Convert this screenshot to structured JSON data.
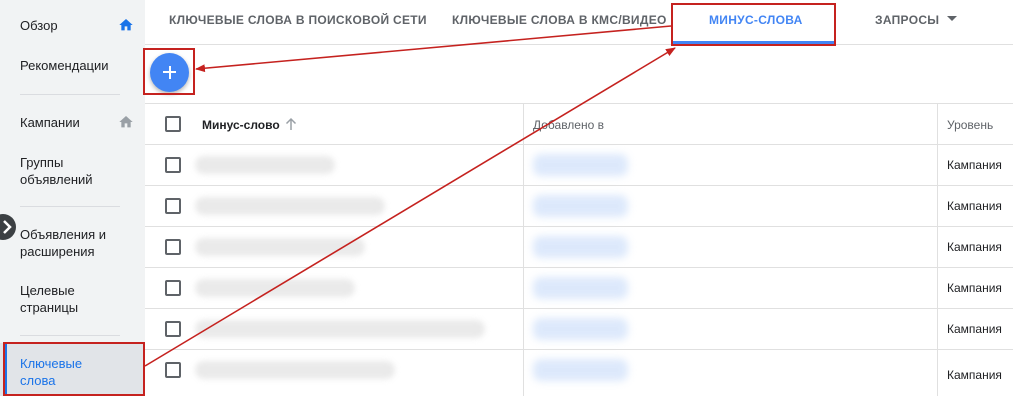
{
  "sidebar": {
    "items": [
      {
        "label": "Обзор",
        "icon": "home-icon"
      },
      {
        "label": "Рекомендации"
      },
      {
        "label": "Кампании",
        "icon": "home-icon"
      },
      {
        "label": "Группы\nобъявлений"
      },
      {
        "label": "Объявления и\nрасширения"
      },
      {
        "label": "Целевые\nстраницы"
      },
      {
        "label": "Ключевые\nслова",
        "active": true
      }
    ]
  },
  "tabs": [
    {
      "label": "КЛЮЧЕВЫЕ СЛОВА В ПОИСКОВОЙ СЕТИ"
    },
    {
      "label": "КЛЮЧЕВЫЕ СЛОВА В КМС/ВИДЕО"
    },
    {
      "label": "МИНУС-СЛОВА",
      "active": true
    },
    {
      "label": "ЗАПРОСЫ"
    }
  ],
  "table": {
    "columns": [
      "Минус-слово",
      "Добавлено в",
      "Уровень"
    ],
    "rows": [
      {
        "level": "Кампания"
      },
      {
        "level": "Кампания"
      },
      {
        "level": "Кампания"
      },
      {
        "level": "Кампания"
      },
      {
        "level": "Кампания"
      },
      {
        "level": "Кампания"
      }
    ]
  },
  "colors": {
    "accent": "#4285f4",
    "annotation": "#c5221f"
  }
}
